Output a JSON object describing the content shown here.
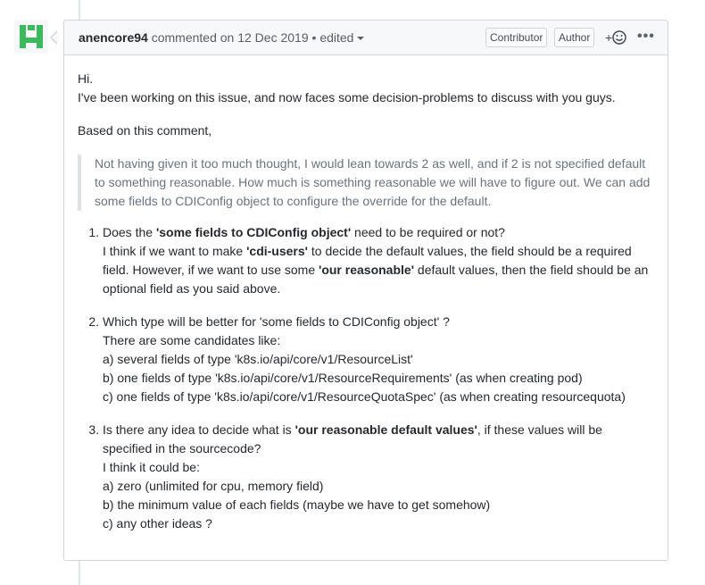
{
  "comment": {
    "author": "anencore94",
    "action_text": " commented on ",
    "date": "12 Dec 2019",
    "separator": " • ",
    "edited_label": "edited",
    "badges": {
      "contributor": "Contributor",
      "author": "Author"
    },
    "reaction_plus": "+",
    "more_label": "•••"
  },
  "body": {
    "greeting": "Hi.",
    "intro": "I've been working on this issue, and now faces some decision-problems to discuss with you guys.",
    "based_on": "Based on this comment,",
    "quote": "Not having given it too much thought, I would lean towards 2 as well, and if 2 is not specified default to something reasonable. How much is something reasonable we will have to figure out. We can add some fields to CDIConfig object to configure the override for the default.",
    "items": [
      {
        "q_pre": "Does the ",
        "q_bold": "'some fields to CDIConfig object'",
        "q_post": " need to be required or not?",
        "a1": "I think if we want to make ",
        "a1_bold": "'cdi-users'",
        "a2": " to decide the default values, the field should be a required field. However, if we want to use some ",
        "a2_bold": "'our reasonable'",
        "a3": " default values, then the field should be an optional field as you said above."
      },
      {
        "question": "Which type will be better for 'some fields to CDIConfig object' ?",
        "lines": [
          "There are some candidates like:",
          "a) several fields of type 'k8s.io/api/core/v1/ResourceList'",
          "b) one fields of type 'k8s.io/api/core/v1/ResourceRequirements' (as when creating pod)",
          "c) one fields of type 'k8s.io/api/core/v1/ResourceQuotaSpec' (as when creating resourcequota)"
        ]
      },
      {
        "q_pre": "Is there any idea to decide what is ",
        "q_bold": "'our reasonable default values'",
        "q_post": ", if these values will be specified in the sourcecode?",
        "lines": [
          "I think it could be:",
          "a) zero (unlimited for cpu, memory field)",
          "b) the minimum value of each fields (maybe we have to get somehow)",
          "c) any other ideas ?"
        ]
      }
    ]
  },
  "colors": {
    "border": "#d1d5da",
    "header_bg": "#f6f8fa",
    "avatar": "#3cb95d"
  }
}
